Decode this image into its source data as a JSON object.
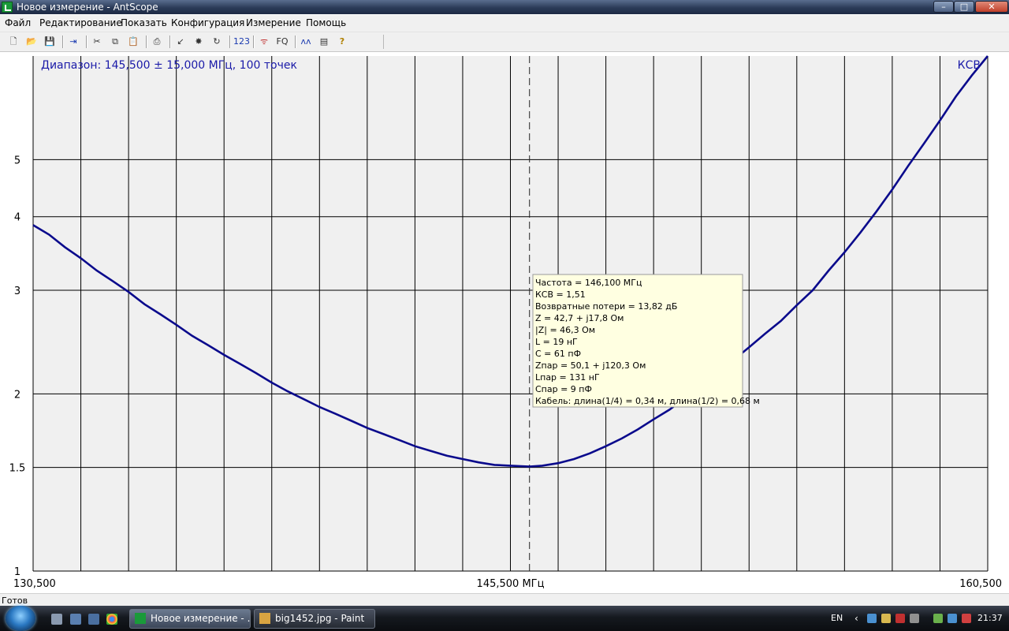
{
  "window": {
    "title": "Новое измерение - AntScope",
    "minimize_glyph": "–",
    "maximize_glyph": "□",
    "close_glyph": "✕"
  },
  "menu": [
    "Файл",
    "Редактирование",
    "Показать",
    "Конфигурация",
    "Измерение",
    "Помощь"
  ],
  "toolbar": [
    {
      "name": "new-icon",
      "glyph": "🗋"
    },
    {
      "name": "open-icon",
      "glyph": "📂"
    },
    {
      "name": "save-icon",
      "glyph": "💾"
    },
    {
      "sep": true
    },
    {
      "name": "export-icon",
      "glyph": "⇥"
    },
    {
      "sep": true
    },
    {
      "name": "cut-icon",
      "glyph": "✂"
    },
    {
      "name": "copy-icon",
      "glyph": "⧉"
    },
    {
      "name": "paste-icon",
      "glyph": "📋"
    },
    {
      "sep": true
    },
    {
      "name": "print-icon",
      "glyph": "⎙"
    },
    {
      "sep": true
    },
    {
      "name": "chart-icon",
      "glyph": "↙"
    },
    {
      "name": "measure-icon",
      "glyph": "✸"
    },
    {
      "name": "refresh-icon",
      "glyph": "↻"
    },
    {
      "sep": true
    },
    {
      "name": "numbers-icon",
      "glyph": "123"
    },
    {
      "sep": true
    },
    {
      "name": "antenna-icon",
      "glyph": "ᯤ"
    },
    {
      "name": "fq-icon",
      "glyph": "FQ"
    },
    {
      "sep": true
    },
    {
      "name": "traces-icon",
      "glyph": "ʌʌ"
    },
    {
      "name": "notes-icon",
      "glyph": "▤"
    },
    {
      "name": "help-icon",
      "glyph": "?"
    }
  ],
  "chart_data": {
    "type": "line",
    "title": "Диапазон: 145,500 ± 15,000 МГц, 100 точек",
    "series_label": "КСВ",
    "x_range": [
      130.5,
      160.5
    ],
    "x_tick_labels": {
      "left": "130,500",
      "center": "145,500 МГц",
      "right": "160,500"
    },
    "y_ticks": [
      1,
      1.5,
      2,
      3,
      4,
      5
    ],
    "y_tick_labels": [
      "1",
      "1.5",
      "2",
      "3",
      "4",
      "5"
    ],
    "y_scale": "log",
    "grid": true,
    "x_grid_count": 20,
    "marker_x": 146.1,
    "series": [
      {
        "color": "#0a0a8c",
        "points": [
          [
            130.5,
            3.87
          ],
          [
            131.0,
            3.73
          ],
          [
            131.5,
            3.55
          ],
          [
            132.0,
            3.4
          ],
          [
            132.5,
            3.24
          ],
          [
            133.0,
            3.11
          ],
          [
            133.5,
            2.98
          ],
          [
            134.0,
            2.84
          ],
          [
            134.5,
            2.73
          ],
          [
            135.0,
            2.62
          ],
          [
            135.5,
            2.51
          ],
          [
            136.0,
            2.42
          ],
          [
            136.5,
            2.33
          ],
          [
            137.0,
            2.25
          ],
          [
            137.5,
            2.17
          ],
          [
            138.0,
            2.09
          ],
          [
            138.5,
            2.02
          ],
          [
            139.0,
            1.96
          ],
          [
            139.5,
            1.9
          ],
          [
            140.0,
            1.85
          ],
          [
            140.5,
            1.8
          ],
          [
            141.0,
            1.75
          ],
          [
            141.5,
            1.71
          ],
          [
            142.0,
            1.67
          ],
          [
            142.5,
            1.63
          ],
          [
            143.0,
            1.6
          ],
          [
            143.5,
            1.57
          ],
          [
            144.0,
            1.55
          ],
          [
            144.5,
            1.53
          ],
          [
            145.0,
            1.515
          ],
          [
            145.5,
            1.51
          ],
          [
            146.1,
            1.505
          ],
          [
            146.5,
            1.51
          ],
          [
            147.0,
            1.525
          ],
          [
            147.5,
            1.55
          ],
          [
            148.0,
            1.585
          ],
          [
            148.5,
            1.63
          ],
          [
            149.0,
            1.68
          ],
          [
            149.5,
            1.74
          ],
          [
            150.0,
            1.81
          ],
          [
            150.5,
            1.88
          ],
          [
            151.0,
            1.97
          ],
          [
            151.5,
            2.06
          ],
          [
            152.0,
            2.17
          ],
          [
            152.5,
            2.28
          ],
          [
            153.0,
            2.4
          ],
          [
            153.5,
            2.53
          ],
          [
            154.0,
            2.66
          ],
          [
            154.5,
            2.83
          ],
          [
            155.0,
            3.0
          ],
          [
            155.5,
            3.24
          ],
          [
            156.0,
            3.48
          ],
          [
            156.5,
            3.76
          ],
          [
            157.0,
            4.08
          ],
          [
            157.5,
            4.45
          ],
          [
            158.0,
            4.88
          ],
          [
            158.5,
            5.33
          ],
          [
            159.0,
            5.83
          ],
          [
            159.5,
            6.4
          ],
          [
            160.0,
            6.95
          ],
          [
            160.5,
            7.5
          ]
        ]
      }
    ],
    "tooltip": [
      "Частота = 146,100 МГц",
      "КСВ = 1,51",
      "Возвратные потери = 13,82 дБ",
      "Z = 42,7 + j17,8 Ом",
      "|Z| = 46,3 Ом",
      "L = 19 нГ",
      "C = 61 пФ",
      "Zпар = 50,1 + j120,3 Ом",
      "Lпар = 131 нГ",
      "Cпар = 9 пФ",
      "Кабель: длина(1/4) = 0,34 м, длина(1/2) = 0,68 м"
    ]
  },
  "status": {
    "text": "Готов"
  },
  "taskbar": {
    "lang": "EN",
    "clock": "21:37",
    "tasks": [
      {
        "label": "Новое измерение - ...",
        "active": true
      },
      {
        "label": "big1452.jpg - Paint",
        "active": false
      }
    ]
  }
}
